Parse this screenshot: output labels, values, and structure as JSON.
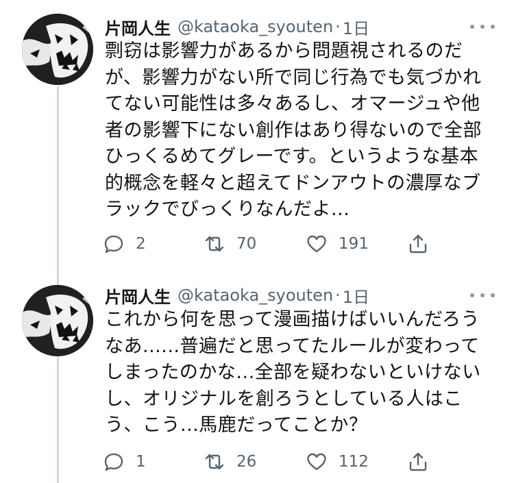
{
  "tweets": [
    {
      "display_name": "片岡人生",
      "handle": "@kataoka_syouten",
      "separator": "·",
      "time": "1日",
      "lines": [
        "剽窃は影響力があるから問題視されるのだ",
        "が、影響力がない所で同じ行為でも気づかれ",
        "てない可能性は多々あるし、オマージュや他",
        "者の影響下にない創作はあり得ないので全部",
        "ひっくるめてグレーです。というような基本",
        "的概念を軽々と超えてドンアウトの濃厚なブ",
        "ラックでびっくりなんだよ..."
      ],
      "replies": "2",
      "retweets": "70",
      "likes": "191"
    },
    {
      "display_name": "片岡人生",
      "handle": "@kataoka_syouten",
      "separator": "·",
      "time": "1日",
      "lines": [
        "これから何を思って漫画描けばいいんだろう",
        "なあ......普遍だと思ってたルールが変わって",
        "しまったのかな...全部を疑わないといけない",
        "し、オリジナルを創ろうとしている人はこ",
        "う、こう...馬鹿だってことか？"
      ],
      "replies": "1",
      "retweets": "26",
      "likes": "112"
    }
  ],
  "icons": {
    "more": "more-horizontal-icon",
    "reply": "reply-bubble-icon",
    "retweet": "retweet-icon",
    "like": "heart-icon",
    "share": "share-icon"
  },
  "colors": {
    "text": "#0f1419",
    "secondary": "#536471",
    "thread_line": "#cfd9de"
  }
}
